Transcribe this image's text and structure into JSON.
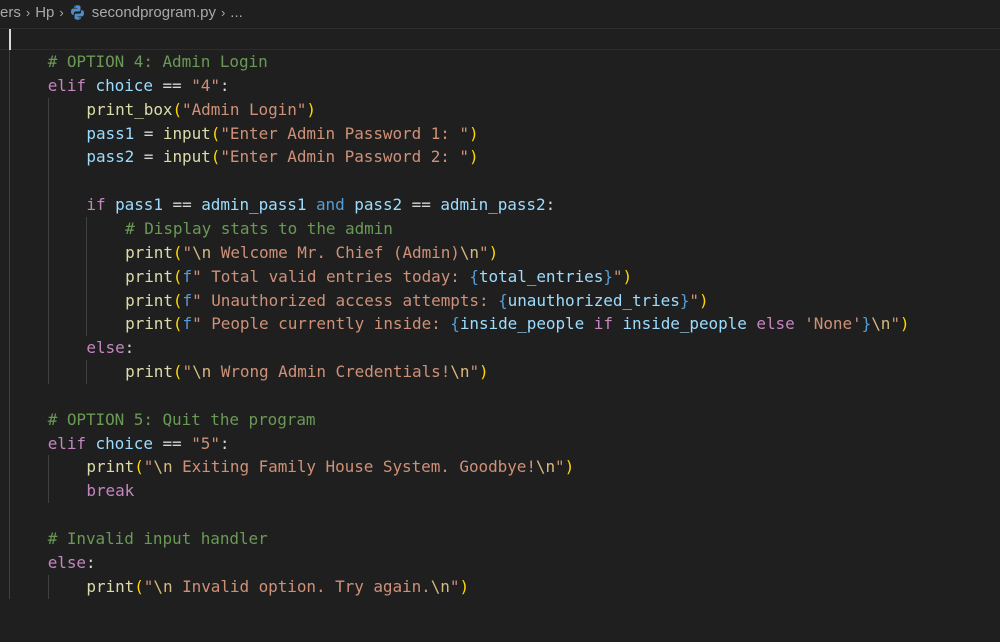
{
  "breadcrumb": {
    "segments": [
      "ers",
      "Hp",
      "secondprogram.py",
      "..."
    ],
    "separator": "›"
  },
  "editor": {
    "colors": {
      "background": "#1f1f1f",
      "comment": "#6a9955",
      "keyword": "#569cd6",
      "control": "#c586c0",
      "function": "#dcdcaa",
      "variable": "#9cdcfe",
      "string": "#ce9178",
      "escape": "#d7ba7d",
      "bracket1": "#ffd700",
      "bracket2": "#da70d6",
      "bracket3": "#179fff",
      "plain": "#d4d4d4"
    },
    "lines": [
      {
        "indent": 1,
        "tokens": [
          {
            "t": "# OPTION 4: Admin Login",
            "c": "comment"
          }
        ]
      },
      {
        "indent": 1,
        "tokens": [
          {
            "t": "elif",
            "c": "control"
          },
          {
            "t": " ",
            "c": "plain"
          },
          {
            "t": "choice",
            "c": "variable"
          },
          {
            "t": " == ",
            "c": "plain"
          },
          {
            "t": "\"4\"",
            "c": "string"
          },
          {
            "t": ":",
            "c": "plain"
          }
        ]
      },
      {
        "indent": 2,
        "tokens": [
          {
            "t": "print_box",
            "c": "function"
          },
          {
            "t": "(",
            "c": "bracket1"
          },
          {
            "t": "\"Admin Login\"",
            "c": "string"
          },
          {
            "t": ")",
            "c": "bracket1"
          }
        ]
      },
      {
        "indent": 2,
        "tokens": [
          {
            "t": "pass1",
            "c": "variable"
          },
          {
            "t": " = ",
            "c": "plain"
          },
          {
            "t": "input",
            "c": "function"
          },
          {
            "t": "(",
            "c": "bracket1"
          },
          {
            "t": "\"Enter Admin Password 1: \"",
            "c": "string"
          },
          {
            "t": ")",
            "c": "bracket1"
          }
        ]
      },
      {
        "indent": 2,
        "tokens": [
          {
            "t": "pass2",
            "c": "variable"
          },
          {
            "t": " = ",
            "c": "plain"
          },
          {
            "t": "input",
            "c": "function"
          },
          {
            "t": "(",
            "c": "bracket1"
          },
          {
            "t": "\"Enter Admin Password 2: \"",
            "c": "string"
          },
          {
            "t": ")",
            "c": "bracket1"
          }
        ]
      },
      {
        "indent": 0,
        "tokens": []
      },
      {
        "indent": 2,
        "tokens": [
          {
            "t": "if",
            "c": "control"
          },
          {
            "t": " ",
            "c": "plain"
          },
          {
            "t": "pass1",
            "c": "variable"
          },
          {
            "t": " == ",
            "c": "plain"
          },
          {
            "t": "admin_pass1",
            "c": "variable"
          },
          {
            "t": " ",
            "c": "plain"
          },
          {
            "t": "and",
            "c": "keyword"
          },
          {
            "t": " ",
            "c": "plain"
          },
          {
            "t": "pass2",
            "c": "variable"
          },
          {
            "t": " == ",
            "c": "plain"
          },
          {
            "t": "admin_pass2",
            "c": "variable"
          },
          {
            "t": ":",
            "c": "plain"
          }
        ]
      },
      {
        "indent": 3,
        "tokens": [
          {
            "t": "# Display stats to the admin",
            "c": "comment"
          }
        ]
      },
      {
        "indent": 3,
        "tokens": [
          {
            "t": "print",
            "c": "function"
          },
          {
            "t": "(",
            "c": "bracket1"
          },
          {
            "t": "\"",
            "c": "string"
          },
          {
            "t": "\\n",
            "c": "escape"
          },
          {
            "t": " Welcome Mr. Chief (Admin)",
            "c": "string"
          },
          {
            "t": "\\n",
            "c": "escape"
          },
          {
            "t": "\"",
            "c": "string"
          },
          {
            "t": ")",
            "c": "bracket1"
          }
        ]
      },
      {
        "indent": 3,
        "tokens": [
          {
            "t": "print",
            "c": "function"
          },
          {
            "t": "(",
            "c": "bracket1"
          },
          {
            "t": "f",
            "c": "keyword"
          },
          {
            "t": "\" Total valid entries today: ",
            "c": "string"
          },
          {
            "t": "{",
            "c": "keyword"
          },
          {
            "t": "total_entries",
            "c": "variable"
          },
          {
            "t": "}",
            "c": "keyword"
          },
          {
            "t": "\"",
            "c": "string"
          },
          {
            "t": ")",
            "c": "bracket1"
          }
        ]
      },
      {
        "indent": 3,
        "tokens": [
          {
            "t": "print",
            "c": "function"
          },
          {
            "t": "(",
            "c": "bracket1"
          },
          {
            "t": "f",
            "c": "keyword"
          },
          {
            "t": "\" Unauthorized access attempts: ",
            "c": "string"
          },
          {
            "t": "{",
            "c": "keyword"
          },
          {
            "t": "unauthorized_tries",
            "c": "variable"
          },
          {
            "t": "}",
            "c": "keyword"
          },
          {
            "t": "\"",
            "c": "string"
          },
          {
            "t": ")",
            "c": "bracket1"
          }
        ]
      },
      {
        "indent": 3,
        "tokens": [
          {
            "t": "print",
            "c": "function"
          },
          {
            "t": "(",
            "c": "bracket1"
          },
          {
            "t": "f",
            "c": "keyword"
          },
          {
            "t": "\" People currently inside: ",
            "c": "string"
          },
          {
            "t": "{",
            "c": "keyword"
          },
          {
            "t": "inside_people",
            "c": "variable"
          },
          {
            "t": " ",
            "c": "plain"
          },
          {
            "t": "if",
            "c": "control"
          },
          {
            "t": " ",
            "c": "plain"
          },
          {
            "t": "inside_people",
            "c": "variable"
          },
          {
            "t": " ",
            "c": "plain"
          },
          {
            "t": "else",
            "c": "control"
          },
          {
            "t": " ",
            "c": "plain"
          },
          {
            "t": "'None'",
            "c": "string"
          },
          {
            "t": "}",
            "c": "keyword"
          },
          {
            "t": "\\n",
            "c": "escape"
          },
          {
            "t": "\"",
            "c": "string"
          },
          {
            "t": ")",
            "c": "bracket1"
          }
        ]
      },
      {
        "indent": 2,
        "tokens": [
          {
            "t": "else",
            "c": "control"
          },
          {
            "t": ":",
            "c": "plain"
          }
        ]
      },
      {
        "indent": 3,
        "tokens": [
          {
            "t": "print",
            "c": "function"
          },
          {
            "t": "(",
            "c": "bracket1"
          },
          {
            "t": "\"",
            "c": "string"
          },
          {
            "t": "\\n",
            "c": "escape"
          },
          {
            "t": " Wrong Admin Credentials!",
            "c": "string"
          },
          {
            "t": "\\n",
            "c": "escape"
          },
          {
            "t": "\"",
            "c": "string"
          },
          {
            "t": ")",
            "c": "bracket1"
          }
        ]
      },
      {
        "indent": 0,
        "tokens": []
      },
      {
        "indent": 1,
        "tokens": [
          {
            "t": "# OPTION 5: Quit the program",
            "c": "comment"
          }
        ]
      },
      {
        "indent": 1,
        "tokens": [
          {
            "t": "elif",
            "c": "control"
          },
          {
            "t": " ",
            "c": "plain"
          },
          {
            "t": "choice",
            "c": "variable"
          },
          {
            "t": " == ",
            "c": "plain"
          },
          {
            "t": "\"5\"",
            "c": "string"
          },
          {
            "t": ":",
            "c": "plain"
          }
        ]
      },
      {
        "indent": 2,
        "tokens": [
          {
            "t": "print",
            "c": "function"
          },
          {
            "t": "(",
            "c": "bracket1"
          },
          {
            "t": "\"",
            "c": "string"
          },
          {
            "t": "\\n",
            "c": "escape"
          },
          {
            "t": " Exiting Family House System. Goodbye!",
            "c": "string"
          },
          {
            "t": "\\n",
            "c": "escape"
          },
          {
            "t": "\"",
            "c": "string"
          },
          {
            "t": ")",
            "c": "bracket1"
          }
        ]
      },
      {
        "indent": 2,
        "tokens": [
          {
            "t": "break",
            "c": "control"
          }
        ]
      },
      {
        "indent": 0,
        "tokens": []
      },
      {
        "indent": 1,
        "tokens": [
          {
            "t": "# Invalid input handler",
            "c": "comment"
          }
        ]
      },
      {
        "indent": 1,
        "tokens": [
          {
            "t": "else",
            "c": "control"
          },
          {
            "t": ":",
            "c": "plain"
          }
        ]
      },
      {
        "indent": 2,
        "tokens": [
          {
            "t": "print",
            "c": "function"
          },
          {
            "t": "(",
            "c": "bracket1"
          },
          {
            "t": "\"",
            "c": "string"
          },
          {
            "t": "\\n",
            "c": "escape"
          },
          {
            "t": " Invalid option. Try again.",
            "c": "string"
          },
          {
            "t": "\\n",
            "c": "escape"
          },
          {
            "t": "\"",
            "c": "string"
          },
          {
            "t": ")",
            "c": "bracket1"
          }
        ]
      }
    ]
  }
}
